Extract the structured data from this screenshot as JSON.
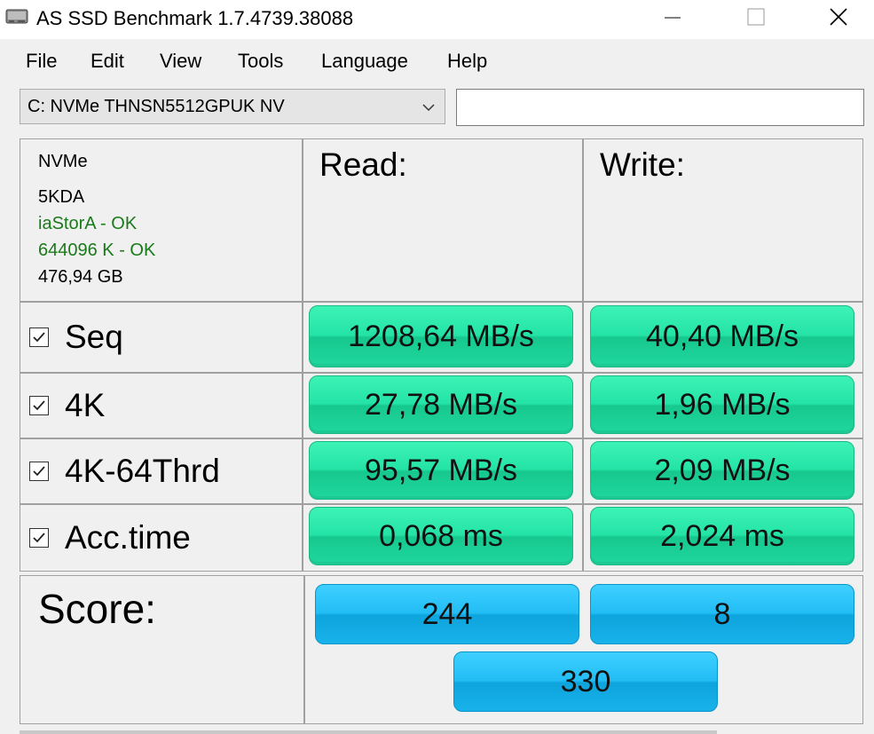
{
  "window": {
    "title": "AS SSD Benchmark 1.7.4739.38088",
    "icons": {
      "app": "drive-icon",
      "minimize": "minimize-icon",
      "maximize": "maximize-icon",
      "close": "close-icon"
    }
  },
  "menu": {
    "items": [
      "File",
      "Edit",
      "View",
      "Tools",
      "Language",
      "Help"
    ]
  },
  "drive": {
    "selected": "C: NVMe THNSN5512GPUK NV",
    "text_box_value": ""
  },
  "info": {
    "controller": "NVMe",
    "firmware": "5KDA",
    "driver_status": "iaStorA - OK",
    "alignment_status": "644096 K - OK",
    "capacity": "476,94 GB"
  },
  "columns": {
    "read": "Read:",
    "write": "Write:"
  },
  "tests": [
    {
      "label": "Seq",
      "checked": true,
      "read": "1208,64 MB/s",
      "write": "40,40 MB/s"
    },
    {
      "label": "4K",
      "checked": true,
      "read": "27,78 MB/s",
      "write": "1,96 MB/s"
    },
    {
      "label": "4K-64Thrd",
      "checked": true,
      "read": "95,57 MB/s",
      "write": "2,09 MB/s"
    },
    {
      "label": "Acc.time",
      "checked": true,
      "read": "0,068 ms",
      "write": "2,024 ms"
    }
  ],
  "score": {
    "label": "Score:",
    "read": "244",
    "write": "8",
    "total": "330"
  },
  "colors": {
    "ok_text": "#1a7a1a",
    "result_green": "#24e3a6",
    "score_blue": "#22bdf5"
  }
}
